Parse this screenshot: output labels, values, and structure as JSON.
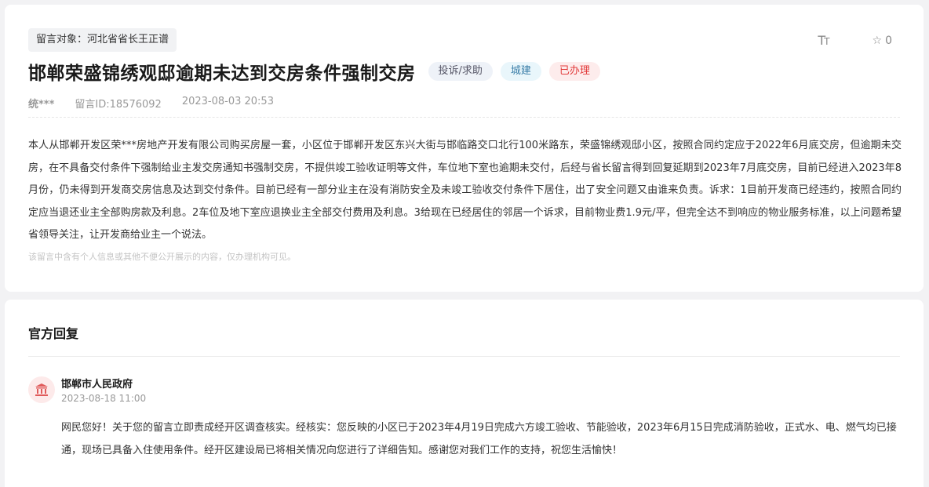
{
  "message": {
    "target_label": "留言对象：河北省省长王正谱",
    "title": "邯郸荣盛锦绣观邸逾期未达到交房条件强制交房",
    "tags": {
      "category": "投诉/求助",
      "domain": "城建",
      "status": "已办理"
    },
    "author": "统***",
    "message_id": "留言ID:18576092",
    "datetime": "2023-08-03 20:53",
    "content": "本人从邯郸开发区荣***房地产开发有限公司购买房屋一套，小区位于邯郸开发区东兴大街与邯临路交口北行100米路东，荣盛锦绣观邸小区，按照合同约定应于2022年6月底交房，但逾期未交房，在不具备交付条件下强制给业主发交房通知书强制交房，不提供竣工验收证明等文件，车位地下室也逾期未交付，后经与省长留言得到回复延期到2023年7月底交房，目前已经进入2023年8月份，仍未得到开发商交房信息及达到交付条件。目前已经有一部分业主在没有消防安全及未竣工验收交付条件下居住，出了安全问题又由谁来负责。诉求：1目前开发商已经违约，按照合同约定应当退还业主全部购房款及利息。2车位及地下室应退换业主全部交付费用及利息。3给现在已经居住的邻居一个诉求，目前物业费1.9元/平，但完全达不到响应的物业服务标准，以上问题希望省领导关注，让开发商给业主一个说法。",
    "privacy_notice": "该留言中含有个人信息或其他不便公开展示的内容，仅办理机构可见。"
  },
  "toolbar": {
    "font_icon_big": "T",
    "font_icon_small": "T",
    "favorite_icon": "☆",
    "favorite_count": "0"
  },
  "reply": {
    "section_title": "官方回复",
    "organization": "邯郸市人民政府",
    "date": "2023-08-18 11:00",
    "content": "网民您好！关于您的留言立即责成经开区调查核实。经核实：您反映的小区已于2023年4月19日完成六方竣工验收、节能验收，2023年6月15日完成消防验收，正式水、电、燃气均已接通，现场已具备入住使用条件。经开区建设局已将相关情况向您进行了详细告知。感谢您对我们工作的支持，祝您生活愉快！"
  },
  "colors": {
    "status_red": "#e23c3c",
    "domain_blue": "#3a7ea8",
    "avatar_bg": "#fdeaea"
  },
  "icons": {
    "font_size_icon": "font-size-icon",
    "favorite_icon": "star-icon",
    "avatar_icon": "government-building-icon"
  }
}
